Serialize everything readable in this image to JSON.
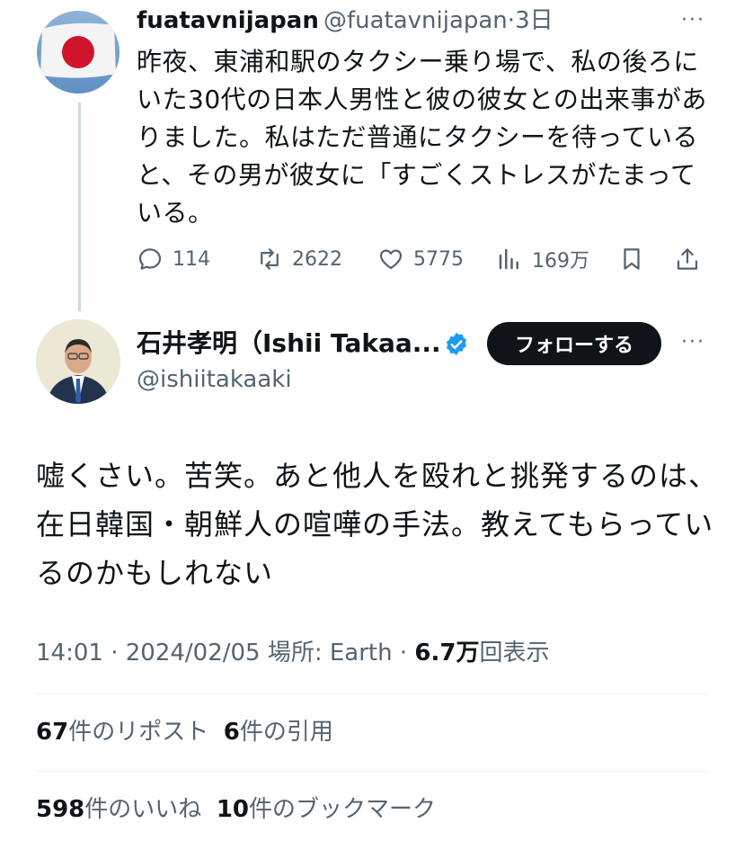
{
  "quoted_tweet": {
    "display_name": "fuatavnijapan",
    "handle": "@fuatavnijapan",
    "separator": "·",
    "time": "3日",
    "more": "···",
    "text": "昨夜、東浦和駅のタクシー乗り場で、私の後ろにいた30代の日本人男性と彼の彼女との出来事がありました。私はただ普通にタクシーを待っていると、その男が彼女に「すごくストレスがたまっている。",
    "actions": {
      "reply_count": "114",
      "retweet_count": "2622",
      "like_count": "5775",
      "view_count": "169万"
    }
  },
  "main_tweet": {
    "display_name": "石井孝明（Ishii Takaa...",
    "handle": "@ishiitakaaki",
    "follow_label": "フォローする",
    "more": "···",
    "text": "嘘くさい。苦笑。あと他人を殴れと挑発するのは、在日韓国・朝鮮人の喧嘩の手法。教えてもらっているのかもしれない",
    "meta": {
      "time": "14:01",
      "sep1": " · ",
      "date": "2024/02/05",
      "location": " 場所: Earth",
      "sep2": " · ",
      "views": "6.7万",
      "views_label": "回表示"
    },
    "stats": {
      "reposts": "67",
      "reposts_label": "件のリポスト",
      "quotes": "6",
      "quotes_label": "件の引用",
      "likes": "598",
      "likes_label": "件のいいね",
      "bookmarks": "10",
      "bookmarks_label": "件のブックマーク"
    }
  },
  "colors": {
    "text": "#0f1419",
    "muted": "#536471",
    "verified": "#1d9bf0",
    "follow_bg": "#0f1419",
    "divider": "#eff3f4"
  },
  "icons": [
    "reply-icon",
    "retweet-icon",
    "like-icon",
    "views-icon",
    "bookmark-icon",
    "share-icon",
    "verified-badge-icon"
  ]
}
